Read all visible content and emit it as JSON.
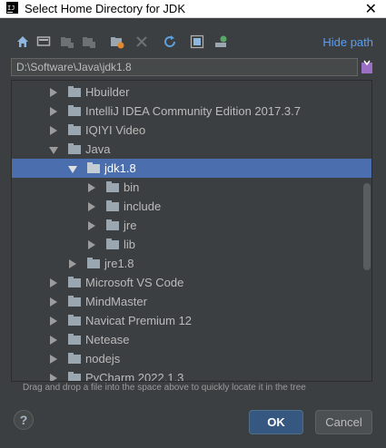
{
  "window": {
    "title": "Select Home Directory for JDK",
    "close_glyph": "✕"
  },
  "toolbar": {
    "icons": [
      "home-icon",
      "desktop-icon",
      "project-folder-icon",
      "module-folder-icon",
      "new-folder-icon",
      "delete-icon",
      "refresh-icon",
      "show-hidden-icon",
      "connect-icon"
    ],
    "hide_path_label": "Hide path"
  },
  "path_field": {
    "value": "D:\\Software\\Java\\jdk1.8"
  },
  "tree": {
    "rows": [
      {
        "label": "Hbuilder",
        "depth": 2,
        "expanded": false,
        "selected": false
      },
      {
        "label": "IntelliJ IDEA Community Edition 2017.3.7",
        "depth": 2,
        "expanded": false,
        "selected": false
      },
      {
        "label": "IQIYI Video",
        "depth": 2,
        "expanded": false,
        "selected": false
      },
      {
        "label": "Java",
        "depth": 2,
        "expanded": true,
        "selected": false
      },
      {
        "label": "jdk1.8",
        "depth": 3,
        "expanded": true,
        "selected": true
      },
      {
        "label": "bin",
        "depth": 4,
        "expanded": false,
        "selected": false
      },
      {
        "label": "include",
        "depth": 4,
        "expanded": false,
        "selected": false
      },
      {
        "label": "jre",
        "depth": 4,
        "expanded": false,
        "selected": false
      },
      {
        "label": "lib",
        "depth": 4,
        "expanded": false,
        "selected": false
      },
      {
        "label": "jre1.8",
        "depth": 3,
        "expanded": false,
        "selected": false
      },
      {
        "label": "Microsoft VS Code",
        "depth": 2,
        "expanded": false,
        "selected": false
      },
      {
        "label": "MindMaster",
        "depth": 2,
        "expanded": false,
        "selected": false
      },
      {
        "label": "Navicat Premium 12",
        "depth": 2,
        "expanded": false,
        "selected": false
      },
      {
        "label": "Netease",
        "depth": 2,
        "expanded": false,
        "selected": false
      },
      {
        "label": "nodejs",
        "depth": 2,
        "expanded": false,
        "selected": false
      },
      {
        "label": "PyCharm 2022.1.3",
        "depth": 2,
        "expanded": false,
        "selected": false
      }
    ]
  },
  "hint": "Drag and drop a file into the space above to quickly locate it in the tree",
  "buttons": {
    "help": "?",
    "ok": "OK",
    "cancel": "Cancel"
  },
  "colors": {
    "background": "#3c3f41",
    "selection": "#4b6eaf",
    "link": "#589df6",
    "ok_button": "#365880"
  }
}
